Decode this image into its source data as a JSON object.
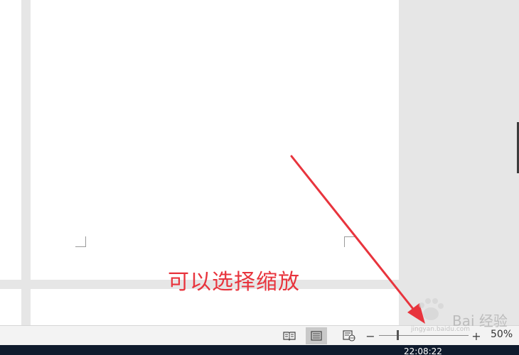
{
  "annotation": {
    "text": "可以选择缩放",
    "color": "#e8343d"
  },
  "status_bar": {
    "views": [
      {
        "name": "read-mode",
        "icon": "book-icon"
      },
      {
        "name": "print-layout",
        "icon": "page-lines-icon",
        "active": true
      },
      {
        "name": "web-layout",
        "icon": "web-page-icon"
      }
    ],
    "zoom": {
      "minus": "−",
      "plus": "+",
      "level": "50%",
      "value_percent": 50
    }
  },
  "taskbar": {
    "time": "22:08:22"
  },
  "watermark": {
    "brand": "Bai 经验",
    "url": "jingyan.baidu.com"
  },
  "colors": {
    "workspace": "#e6e6e6",
    "page": "#ffffff",
    "arrow": "#e8343d",
    "taskbar": "#0f1b2d"
  }
}
